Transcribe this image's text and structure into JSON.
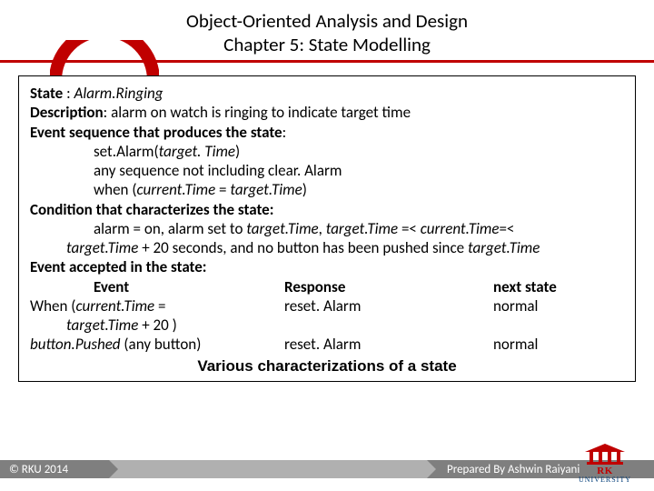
{
  "header": {
    "title_line1": "Object-Oriented Analysis and Design",
    "title_line2": "Chapter 5: State Modelling"
  },
  "box": {
    "state_label": "State",
    "state_value": "Alarm.Ringing",
    "desc_label": "Description",
    "desc_value": "alarm on watch is ringing to indicate target time",
    "evseq_label": "Event sequence that produces the state",
    "evseq_l1_pre": "set.Alarm(",
    "evseq_l1_it": "target. Time",
    "evseq_l1_post": ")",
    "evseq_l2": "any sequence not including clear. Alarm",
    "evseq_l3_pre": "when (",
    "evseq_l3_it1": "current.Time",
    "evseq_l3_mid": " = ",
    "evseq_l3_it2": "target.Time",
    "evseq_l3_post": ")",
    "cond_label": "Condition that characterizes the state:",
    "cond_l1_a": "alarm = on, alarm set to ",
    "cond_l1_it1": "target.Time",
    "cond_l1_b": ", ",
    "cond_l1_it2": "target.Time",
    "cond_l1_c": " =< ",
    "cond_l1_it3": "current.Time",
    "cond_l1_d": "=<",
    "cond_l2_it": "target.Time",
    "cond_l2_rest": " + 20 seconds, and no button has been pushed since ",
    "cond_l2_it2": "target.Time",
    "evacc_label": "Event accepted in the state:",
    "th_event": "Event",
    "th_response": "Response",
    "th_next": "next state",
    "r1_ev_a": "When (",
    "r1_ev_it": "current.Time",
    "r1_ev_b": "  =",
    "r1_ev_line2_it": "target.Time",
    "r1_ev_line2_b": " + 20 )",
    "r1_resp": "reset. Alarm",
    "r1_next": "normal",
    "r2_ev_it": "button.Pushed",
    "r2_ev_b": " (any button)",
    "r2_resp": "reset. Alarm",
    "r2_next": "normal",
    "caption": "Various characterizations of a state"
  },
  "footer": {
    "copyright": "© RKU 2014",
    "prepared": "Prepared By Ashwin Raiyani"
  },
  "logo": {
    "line1": "RK",
    "line2": "UNIVERSITY"
  }
}
